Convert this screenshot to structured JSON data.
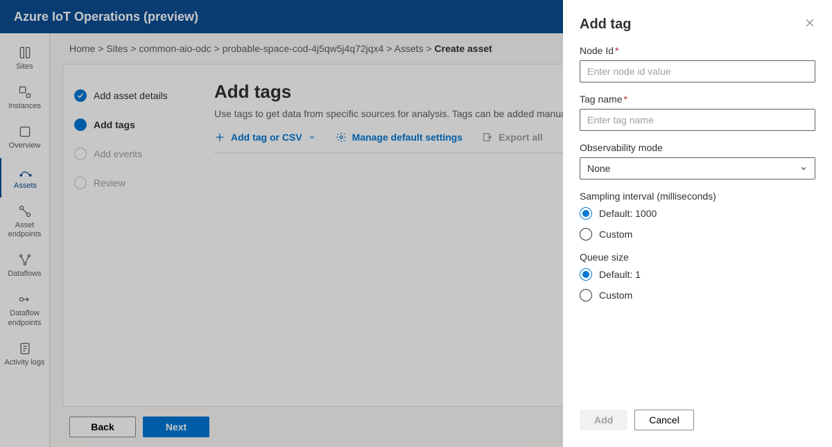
{
  "app_title": "Azure IoT Operations (preview)",
  "left_nav": {
    "items": [
      {
        "label": "Sites"
      },
      {
        "label": "Instances"
      },
      {
        "label": "Overview"
      },
      {
        "label": "Assets"
      },
      {
        "label": "Asset endpoints"
      },
      {
        "label": "Dataflows"
      },
      {
        "label": "Dataflow endpoints"
      },
      {
        "label": "Activity logs"
      }
    ]
  },
  "breadcrumb": {
    "parts": [
      "Home",
      "Sites",
      "common-aio-odc",
      "probable-space-cod-4j5qw5j4q72jqx4",
      "Assets"
    ],
    "current": "Create asset"
  },
  "wizard": {
    "steps": [
      {
        "label": "Add asset details"
      },
      {
        "label": "Add tags"
      },
      {
        "label": "Add events"
      },
      {
        "label": "Review"
      }
    ]
  },
  "page": {
    "title": "Add tags",
    "description": "Use tags to get data from specific sources for analysis. Tags can be added manuall",
    "toolbar": {
      "add": "Add tag or CSV",
      "settings": "Manage default settings",
      "export": "Export all"
    }
  },
  "footer": {
    "back": "Back",
    "next": "Next"
  },
  "panel": {
    "title": "Add tag",
    "node_id": {
      "label": "Node Id",
      "placeholder": "Enter node id value"
    },
    "tag_name": {
      "label": "Tag name",
      "placeholder": "Enter tag name"
    },
    "obs_mode": {
      "label": "Observability mode",
      "value": "None"
    },
    "sampling": {
      "label": "Sampling interval (milliseconds)",
      "default": "Default: 1000",
      "custom": "Custom"
    },
    "queue": {
      "label": "Queue size",
      "default": "Default: 1",
      "custom": "Custom"
    },
    "add_btn": "Add",
    "cancel_btn": "Cancel"
  }
}
